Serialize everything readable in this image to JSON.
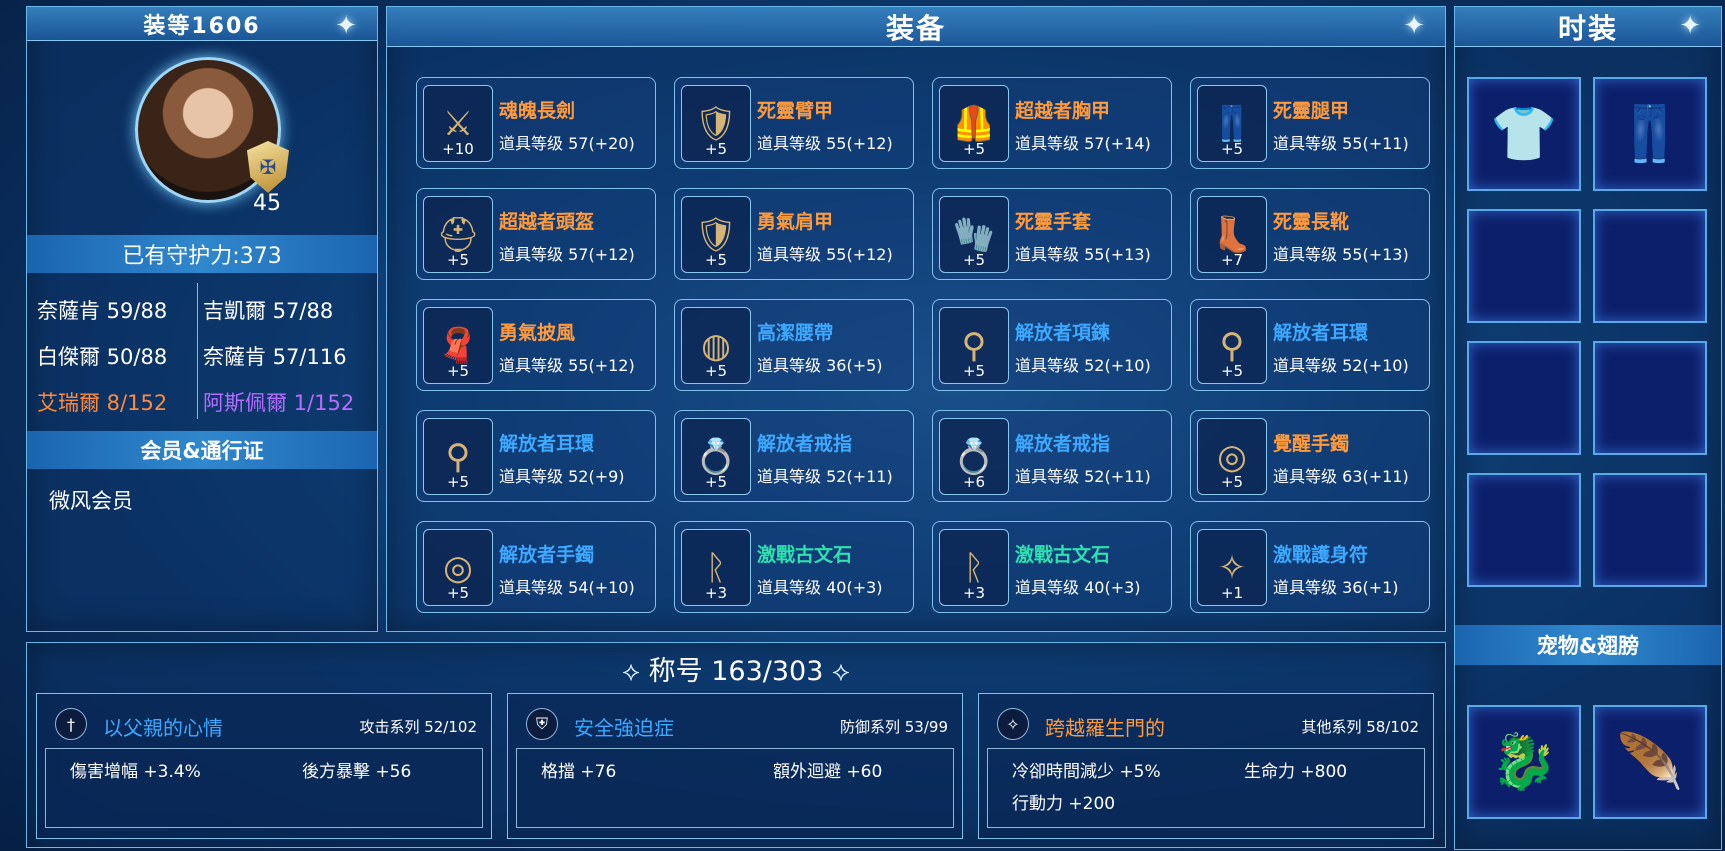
{
  "left_panel": {
    "gear_score": "装等1606",
    "level": "45",
    "guard_power": "已有守护力:373",
    "stats": [
      {
        "label": "奈薩肯 59/88"
      },
      {
        "label": "吉凱爾 57/88"
      },
      {
        "label": "白傑爾 50/88"
      },
      {
        "label": "奈薩肯 57/116"
      },
      {
        "label": "艾瑞爾 8/152",
        "color": "#ff8a3a"
      },
      {
        "label": "阿斯佩爾 1/152",
        "color": "#b66cff"
      }
    ],
    "membership_header": "会员&通行证",
    "membership_value": "微风会员"
  },
  "equipment": {
    "title": "装备",
    "items": [
      {
        "name": "魂魄長劍",
        "level": "道具等级 57(+20)",
        "enh": "+10",
        "color": "#ff9a3a",
        "icon": "sword-icon"
      },
      {
        "name": "死靈臂甲",
        "level": "道具等级 55(+12)",
        "enh": "+5",
        "color": "#ff9a3a",
        "icon": "gauntlet-icon"
      },
      {
        "name": "超越者胸甲",
        "level": "道具等级 57(+14)",
        "enh": "+5",
        "color": "#ff9a3a",
        "icon": "chest-icon"
      },
      {
        "name": "死靈腿甲",
        "level": "道具等级 55(+11)",
        "enh": "+5",
        "color": "#ff9a3a",
        "icon": "legs-icon"
      },
      {
        "name": "超越者頭盔",
        "level": "道具等级 57(+12)",
        "enh": "+5",
        "color": "#ff9a3a",
        "icon": "helmet-icon"
      },
      {
        "name": "勇氣肩甲",
        "level": "道具等级 55(+12)",
        "enh": "+5",
        "color": "#ff9a3a",
        "icon": "shoulder-icon"
      },
      {
        "name": "死靈手套",
        "level": "道具等级 55(+13)",
        "enh": "+5",
        "color": "#ff9a3a",
        "icon": "glove-icon"
      },
      {
        "name": "死靈長靴",
        "level": "道具等级 55(+13)",
        "enh": "+7",
        "color": "#ff9a3a",
        "icon": "boots-icon"
      },
      {
        "name": "勇氣披風",
        "level": "道具等级 55(+12)",
        "enh": "+5",
        "color": "#ff9a3a",
        "icon": "cape-icon"
      },
      {
        "name": "高潔腰帶",
        "level": "道具等级 36(+5)",
        "enh": "+5",
        "color": "#3da8ff",
        "icon": "belt-icon"
      },
      {
        "name": "解放者項鍊",
        "level": "道具等级 52(+10)",
        "enh": "+5",
        "color": "#3da8ff",
        "icon": "necklace-icon"
      },
      {
        "name": "解放者耳環",
        "level": "道具等级 52(+10)",
        "enh": "+5",
        "color": "#3da8ff",
        "icon": "earring-icon"
      },
      {
        "name": "解放者耳環",
        "level": "道具等级 52(+9)",
        "enh": "+5",
        "color": "#3da8ff",
        "icon": "earring-icon"
      },
      {
        "name": "解放者戒指",
        "level": "道具等级 52(+11)",
        "enh": "+5",
        "color": "#3da8ff",
        "icon": "ring-icon"
      },
      {
        "name": "解放者戒指",
        "level": "道具等级 52(+11)",
        "enh": "+6",
        "color": "#3da8ff",
        "icon": "ring-icon"
      },
      {
        "name": "覺醒手鐲",
        "level": "道具等级 63(+11)",
        "enh": "+5",
        "color": "#ff9a3a",
        "icon": "bracelet-icon"
      },
      {
        "name": "解放者手鐲",
        "level": "道具等级 54(+10)",
        "enh": "+5",
        "color": "#3da8ff",
        "icon": "bracelet-icon"
      },
      {
        "name": "激戰古文石",
        "level": "道具等级 40(+3)",
        "enh": "+3",
        "color": "#2fe0b0",
        "icon": "rune-stone-icon"
      },
      {
        "name": "激戰古文石",
        "level": "道具等级 40(+3)",
        "enh": "+3",
        "color": "#2fe0b0",
        "icon": "rune-stone-icon"
      },
      {
        "name": "激戰護身符",
        "level": "道具等级 36(+1)",
        "enh": "+1",
        "color": "#3da8ff",
        "icon": "amulet-icon"
      }
    ]
  },
  "costume": {
    "title": "时装",
    "pet_wings_header": "宠物&翅膀"
  },
  "titles": {
    "header": "称号 163/303",
    "cards": [
      {
        "name": "以父親的心情",
        "series": "攻击系列 52/102",
        "name_color": "#3da8ff",
        "icon": "sword-badge-icon",
        "stats": [
          "傷害增幅 +3.4%",
          "後方暴擊 +56"
        ]
      },
      {
        "name": "安全強迫症",
        "series": "防御系列 53/99",
        "name_color": "#3da8ff",
        "icon": "shield-badge-icon",
        "stats": [
          "格擋 +76",
          "額外迴避 +60"
        ]
      },
      {
        "name": "跨越羅生門的",
        "series": "其他系列 58/102",
        "name_color": "#ff9a3a",
        "icon": "star-badge-icon",
        "stats": [
          "冷卻時間減少 +5%",
          "生命力 +800",
          "行動力 +200"
        ]
      }
    ]
  }
}
